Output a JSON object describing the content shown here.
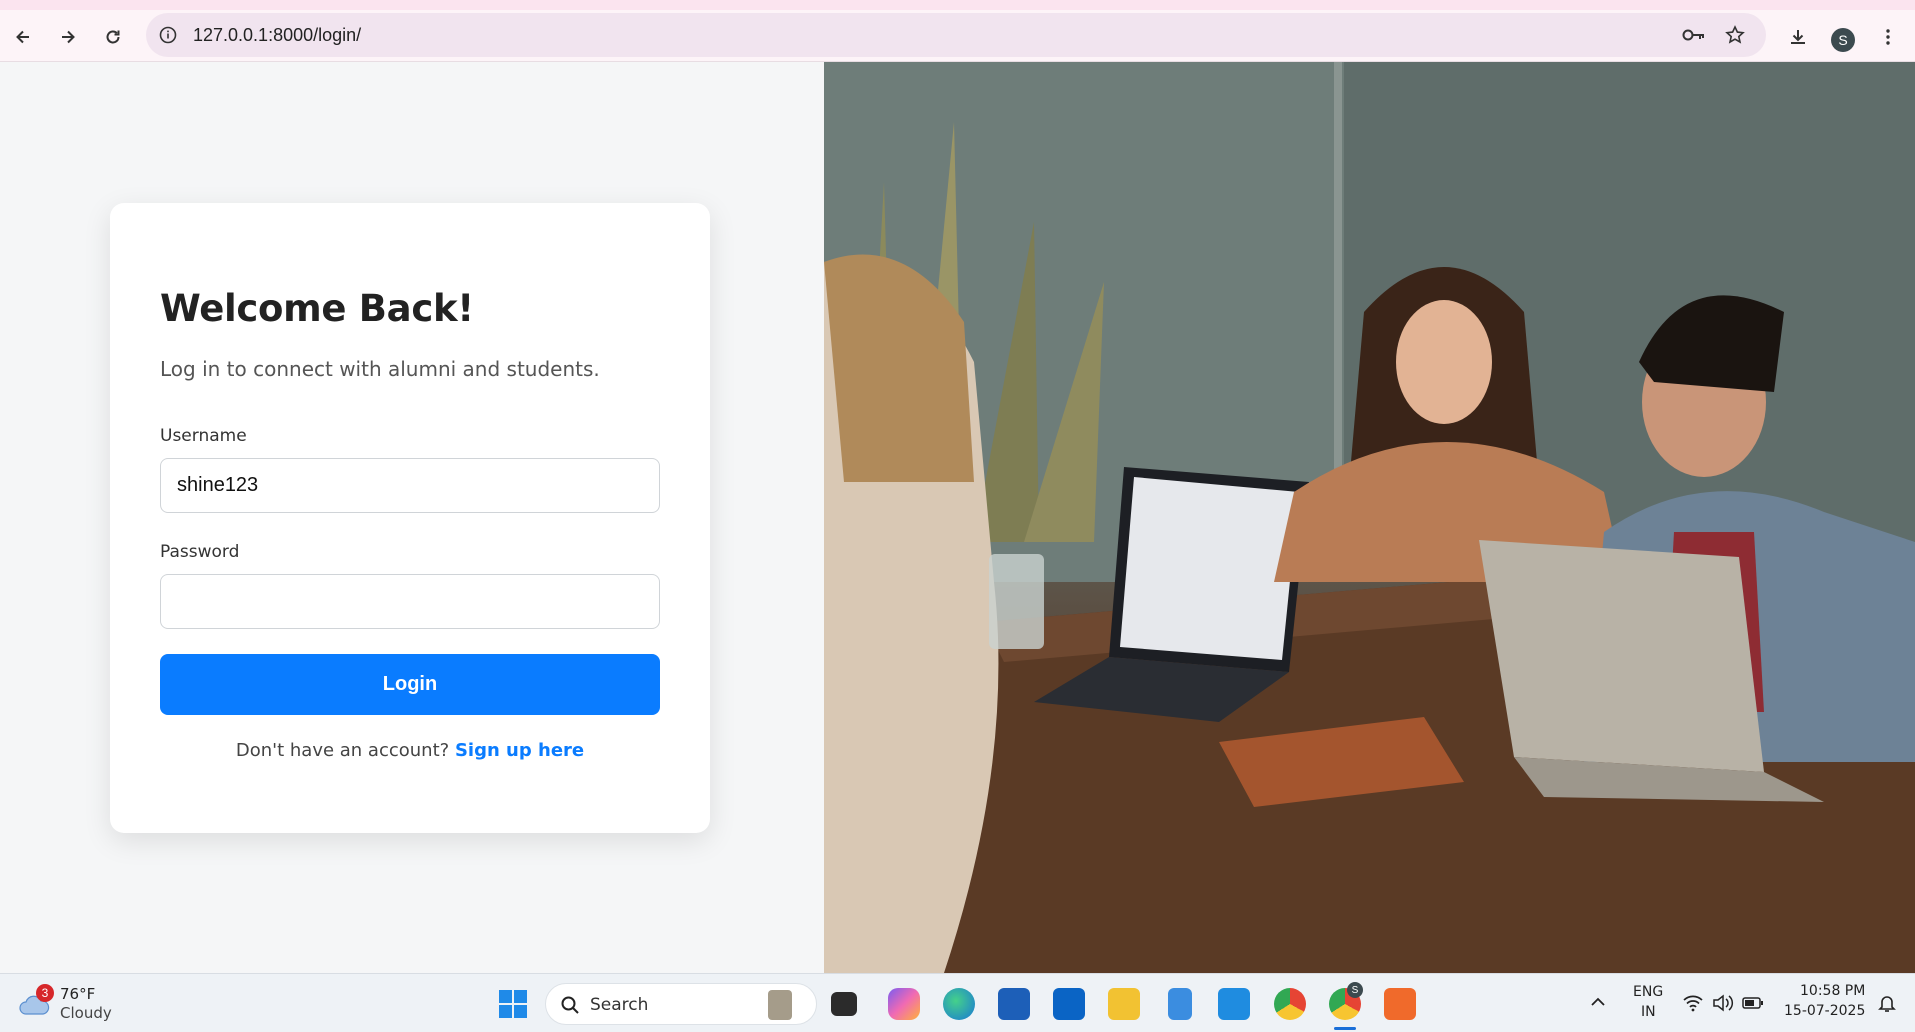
{
  "browser": {
    "url": "127.0.0.1:8000/login/",
    "profile_initial": "S"
  },
  "login": {
    "title": "Welcome Back!",
    "subtitle": "Log in to connect with alumni and students.",
    "username_label": "Username",
    "username_value": "shine123",
    "password_label": "Password",
    "password_value": "",
    "login_button": "Login",
    "signup_prompt": "Don't have an account?",
    "signup_link": "Sign up here"
  },
  "taskbar": {
    "weather_temp": "76°F",
    "weather_desc": "Cloudy",
    "weather_badge": "3",
    "search_placeholder": "Search",
    "lang_top": "ENG",
    "lang_bottom": "IN",
    "time": "10:58 PM",
    "date": "15-07-2025",
    "chrome_badge": "S"
  }
}
